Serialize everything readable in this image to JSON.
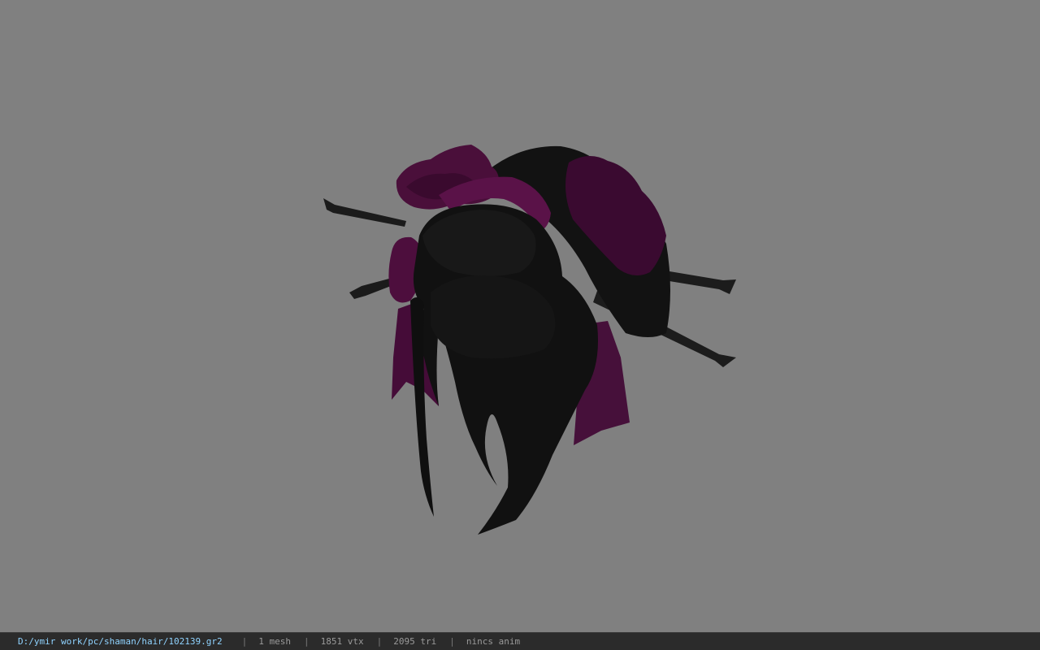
{
  "viewer": {
    "background_color": "#808080",
    "model_colors": {
      "hair": "#141414",
      "flower": "#4a0f3a",
      "ribbon": "#4a0d3c",
      "stick": "#1a1a1a"
    }
  },
  "status_bar": {
    "file_path": "D:/ymir work/pc/shaman/hair/102139.gr2",
    "mesh_count": "1 mesh",
    "vertex_count": "1851 vtx",
    "triangle_count": "2095 tri",
    "anim_status": "nincs anim",
    "separator": "|",
    "path_color": "#8fd3ff"
  }
}
